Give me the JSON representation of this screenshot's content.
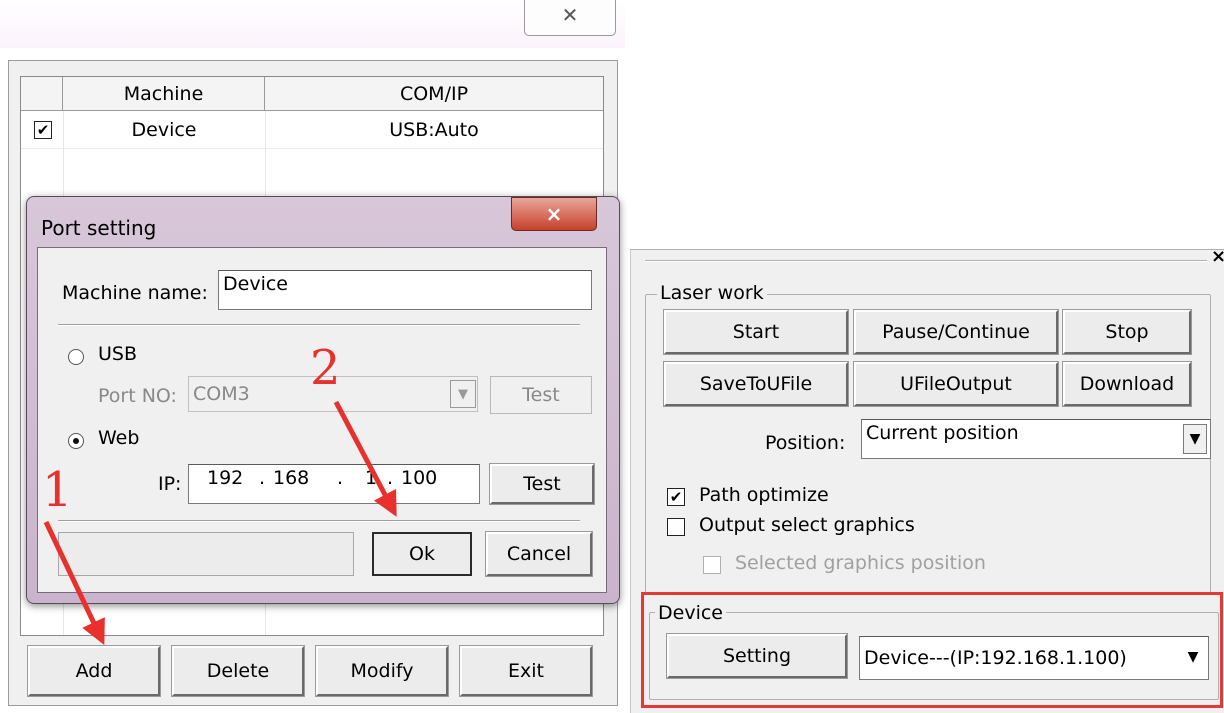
{
  "machine_list": {
    "columns": [
      "Machine",
      "COM/IP"
    ],
    "rows": [
      {
        "checked": true,
        "machine": "Device",
        "com_ip": "USB:Auto"
      }
    ],
    "buttons": {
      "add": "Add",
      "delete": "Delete",
      "modify": "Modify",
      "exit": "Exit"
    }
  },
  "port_dialog": {
    "title": "Port setting",
    "machine_name_label": "Machine name:",
    "machine_name_value": "Device",
    "usb_label": "USB",
    "usb_selected": false,
    "port_no_label": "Port NO:",
    "port_no_value": "COM3",
    "usb_test_label": "Test",
    "web_label": "Web",
    "web_selected": true,
    "ip_label": "IP:",
    "ip_octets": [
      "192",
      "168",
      "1",
      "100"
    ],
    "web_test_label": "Test",
    "ok_label": "Ok",
    "cancel_label": "Cancel"
  },
  "annotations": {
    "step1": "1",
    "step2": "2",
    "arrow_color": "#e8302c",
    "highlight_color": "#e53935"
  },
  "laser_panel": {
    "close_glyph": "×",
    "group_title": "Laser work",
    "buttons": {
      "start": "Start",
      "pause": "Pause/Continue",
      "stop": "Stop",
      "save": "SaveToUFile",
      "ufile": "UFileOutput",
      "download": "Download"
    },
    "position_label": "Position:",
    "position_value": "Current position",
    "path_optimize_label": "Path optimize",
    "path_optimize_checked": true,
    "output_select_label": "Output select graphics",
    "output_select_checked": false,
    "selected_position_label": "Selected graphics position",
    "selected_position_checked": false
  },
  "device_panel": {
    "group_title": "Device",
    "setting_label": "Setting",
    "device_value": "Device---(IP:192.168.1.100)"
  },
  "window": {
    "close_glyph": "✕"
  }
}
